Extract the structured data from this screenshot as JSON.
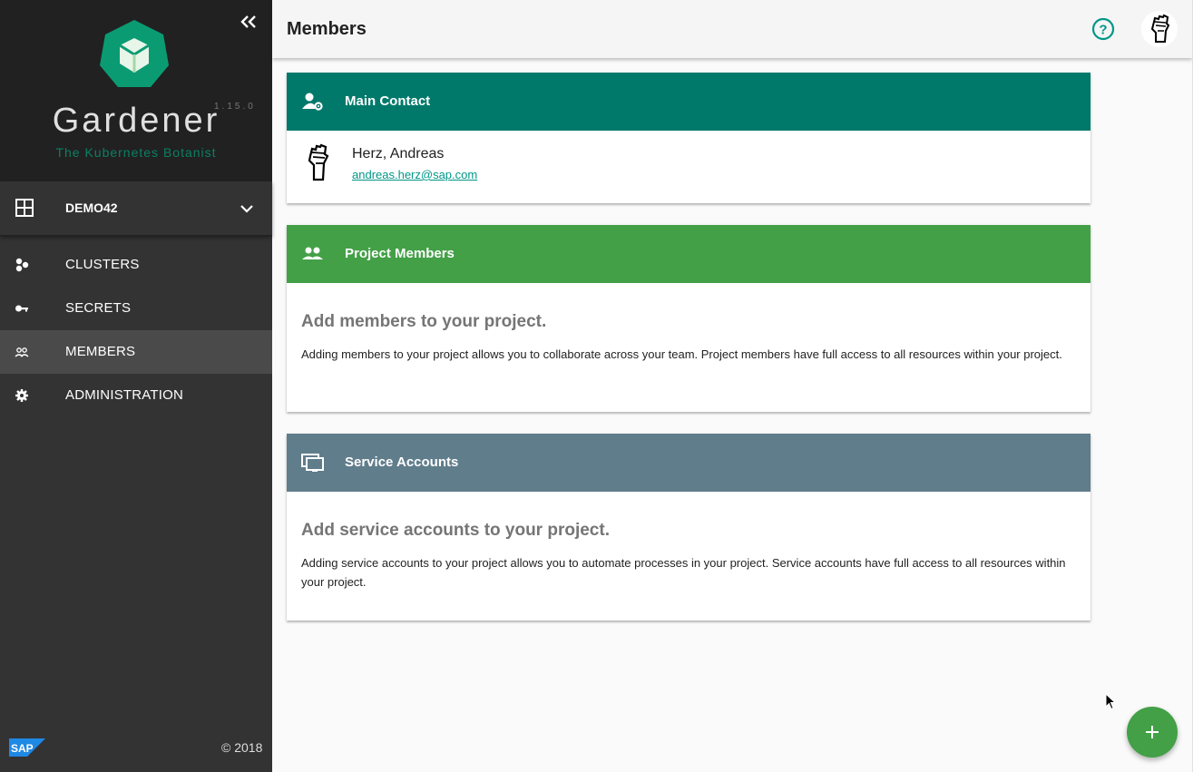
{
  "sidebar": {
    "brand": {
      "title": "Gardener",
      "version": "1.15.0",
      "subtitle": "The Kubernetes Botanist"
    },
    "collapse_icon": "double-chevron-left-icon",
    "project": {
      "name": "DEMO42",
      "icon": "grid-icon",
      "chevron": "chevron-down-icon"
    },
    "nav": [
      {
        "label": "CLUSTERS",
        "icon": "hexagon-cluster-icon",
        "active": false
      },
      {
        "label": "SECRETS",
        "icon": "key-icon",
        "active": false
      },
      {
        "label": "MEMBERS",
        "icon": "people-icon",
        "active": true
      },
      {
        "label": "ADMINISTRATION",
        "icon": "gear-icon",
        "active": false
      }
    ],
    "footer": {
      "logo": "SAP",
      "copyright": "© 2018"
    }
  },
  "header": {
    "title": "Members",
    "help_icon": "help-circle-icon",
    "avatar_icon": "fist-avatar-icon"
  },
  "main_contact": {
    "title": "Main Contact",
    "icon": "account-settings-icon",
    "name": "Herz, Andreas",
    "email": "andreas.herz@sap.com"
  },
  "project_members": {
    "title": "Project Members",
    "icon": "people-icon",
    "empty_title": "Add members to your project.",
    "empty_text": "Adding members to your project allows you to collaborate across your team. Project members have full access to all resources within your project."
  },
  "service_accounts": {
    "title": "Service Accounts",
    "icon": "monitor-multiple-icon",
    "empty_title": "Add service accounts to your project.",
    "empty_text": "Adding service accounts to your project allows you to automate processes in your project. Service accounts have full access to all resources within your project."
  },
  "fab": {
    "icon": "plus-icon"
  },
  "colors": {
    "sidebar_bg": "#333333",
    "main_contact_header": "#00796b",
    "project_members_header": "#43a047",
    "service_accounts_header": "#607d8b",
    "accent": "#009688",
    "fab": "#43a047"
  }
}
